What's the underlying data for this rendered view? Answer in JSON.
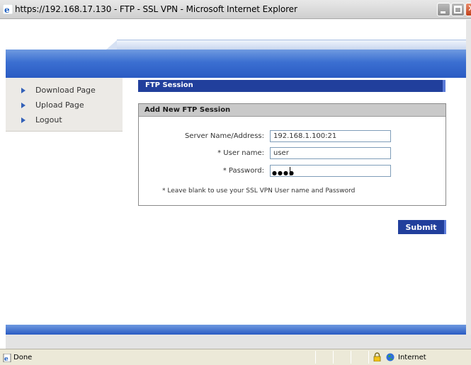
{
  "window": {
    "title": "https://192.168.17.130 - FTP - SSL VPN - Microsoft Internet Explorer"
  },
  "nav": {
    "items": [
      {
        "label": "Download Page",
        "icon": "arrow-right-icon"
      },
      {
        "label": "Upload Page",
        "icon": "arrow-right-icon"
      },
      {
        "label": "Logout",
        "icon": "arrow-right-icon"
      }
    ]
  },
  "section": {
    "title": "FTP Session"
  },
  "form": {
    "header": "Add New FTP Session",
    "server_label": "Server Name/Address:",
    "server_value": "192.168.1.100:21",
    "user_label": "* User name:",
    "user_value": "user",
    "password_label": "* Password:",
    "password_mask": "●●●●",
    "note": "* Leave blank to use your SSL VPN User name and Password",
    "submit_label": "Submit"
  },
  "statusbar": {
    "status_text": "Done",
    "zone_text": "Internet"
  },
  "colors": {
    "accent_blue": "#213f9c",
    "band_blue": "#3b6fd1",
    "nav_bg": "#eceae6"
  }
}
